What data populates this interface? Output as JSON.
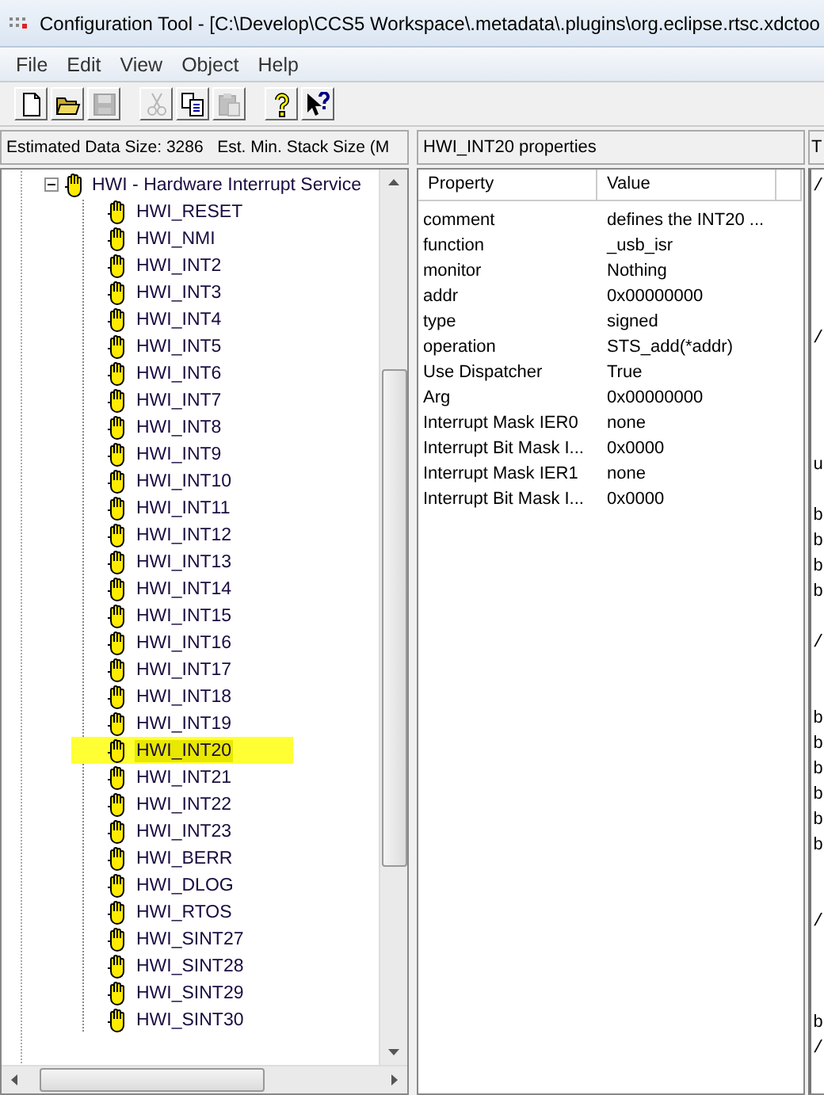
{
  "window": {
    "title": "Configuration Tool - [C:\\Develop\\CCS5 Workspace\\.metadata\\.plugins\\org.eclipse.rtsc.xdctoo"
  },
  "menu": [
    "File",
    "Edit",
    "View",
    "Object",
    "Help"
  ],
  "toolbar": [
    {
      "kind": "new",
      "disabled": false
    },
    {
      "kind": "open",
      "disabled": false
    },
    {
      "kind": "save",
      "disabled": true
    },
    {
      "kind": "sep"
    },
    {
      "kind": "cut",
      "disabled": true
    },
    {
      "kind": "copy",
      "disabled": false
    },
    {
      "kind": "paste",
      "disabled": true
    },
    {
      "kind": "sep"
    },
    {
      "kind": "help",
      "disabled": false
    },
    {
      "kind": "context-help",
      "disabled": false
    }
  ],
  "left_pane": {
    "header": "Estimated Data Size: 3286   Est. Min. Stack Size (M",
    "tree": {
      "label": "HWI - Hardware Interrupt Service",
      "expanded": true,
      "selected": false,
      "children": [
        {
          "label": "HWI_RESET",
          "selected": false
        },
        {
          "label": "HWI_NMI",
          "selected": false
        },
        {
          "label": "HWI_INT2",
          "selected": false
        },
        {
          "label": "HWI_INT3",
          "selected": false
        },
        {
          "label": "HWI_INT4",
          "selected": false
        },
        {
          "label": "HWI_INT5",
          "selected": false
        },
        {
          "label": "HWI_INT6",
          "selected": false
        },
        {
          "label": "HWI_INT7",
          "selected": false
        },
        {
          "label": "HWI_INT8",
          "selected": false
        },
        {
          "label": "HWI_INT9",
          "selected": false
        },
        {
          "label": "HWI_INT10",
          "selected": false
        },
        {
          "label": "HWI_INT11",
          "selected": false
        },
        {
          "label": "HWI_INT12",
          "selected": false
        },
        {
          "label": "HWI_INT13",
          "selected": false
        },
        {
          "label": "HWI_INT14",
          "selected": false
        },
        {
          "label": "HWI_INT15",
          "selected": false
        },
        {
          "label": "HWI_INT16",
          "selected": false
        },
        {
          "label": "HWI_INT17",
          "selected": false
        },
        {
          "label": "HWI_INT18",
          "selected": false
        },
        {
          "label": "HWI_INT19",
          "selected": false
        },
        {
          "label": "HWI_INT20",
          "selected": true
        },
        {
          "label": "HWI_INT21",
          "selected": false
        },
        {
          "label": "HWI_INT22",
          "selected": false
        },
        {
          "label": "HWI_INT23",
          "selected": false
        },
        {
          "label": "HWI_BERR",
          "selected": false
        },
        {
          "label": "HWI_DLOG",
          "selected": false
        },
        {
          "label": "HWI_RTOS",
          "selected": false
        },
        {
          "label": "HWI_SINT27",
          "selected": false
        },
        {
          "label": "HWI_SINT28",
          "selected": false
        },
        {
          "label": "HWI_SINT29",
          "selected": false
        },
        {
          "label": "HWI_SINT30",
          "selected": false
        }
      ]
    }
  },
  "properties": {
    "header": "HWI_INT20 properties",
    "columns": [
      "Property",
      "Value"
    ],
    "rows": [
      [
        "comment",
        "defines the INT20 ..."
      ],
      [
        "function",
        "_usb_isr"
      ],
      [
        "monitor",
        "Nothing"
      ],
      [
        "addr",
        "0x00000000"
      ],
      [
        "type",
        "signed"
      ],
      [
        "operation",
        "STS_add(*addr)"
      ],
      [
        "Use Dispatcher",
        "True"
      ],
      [
        "Arg",
        "0x00000000"
      ],
      [
        "Interrupt Mask IER0",
        "none"
      ],
      [
        "Interrupt Bit Mask I...",
        "0x0000"
      ],
      [
        "Interrupt Mask IER1",
        "none"
      ],
      [
        "Interrupt Bit Mask I...",
        "0x0000"
      ]
    ]
  },
  "right_pane": {
    "header": "T",
    "lines": [
      {
        "kind": "text",
        "text": "/"
      },
      {
        "kind": "blank"
      },
      {
        "kind": "blank"
      },
      {
        "kind": "blank"
      },
      {
        "kind": "blank"
      },
      {
        "kind": "blank"
      },
      {
        "kind": "text",
        "text": "/"
      },
      {
        "kind": "blank"
      },
      {
        "kind": "blank"
      },
      {
        "kind": "blank"
      },
      {
        "kind": "blank"
      },
      {
        "kind": "text",
        "text": "u"
      },
      {
        "kind": "blank"
      },
      {
        "kind": "text",
        "text": "b"
      },
      {
        "kind": "text",
        "text": "b"
      },
      {
        "kind": "text",
        "text": "b"
      },
      {
        "kind": "text",
        "text": "b"
      },
      {
        "kind": "blank"
      },
      {
        "kind": "text",
        "text": "/"
      },
      {
        "kind": "blank"
      },
      {
        "kind": "blank"
      },
      {
        "kind": "text",
        "text": "b"
      },
      {
        "kind": "text",
        "text": "b"
      },
      {
        "kind": "text",
        "text": "b"
      },
      {
        "kind": "text",
        "text": "b"
      },
      {
        "kind": "text",
        "text": "b"
      },
      {
        "kind": "text",
        "text": "b"
      },
      {
        "kind": "blank"
      },
      {
        "kind": "blank"
      },
      {
        "kind": "text",
        "text": "/"
      },
      {
        "kind": "blank"
      },
      {
        "kind": "blank"
      },
      {
        "kind": "blank"
      },
      {
        "kind": "text",
        "text": "b"
      },
      {
        "kind": "text",
        "text": "/"
      }
    ]
  }
}
